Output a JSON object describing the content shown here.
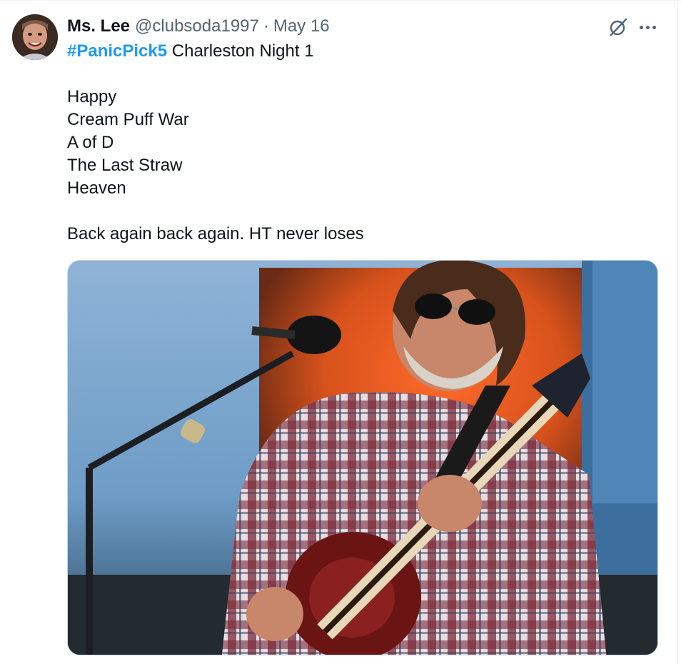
{
  "tweet": {
    "author": {
      "display_name": "Ms. Lee",
      "handle": "@clubsoda1997",
      "avatar_icon": "profile-photo"
    },
    "separator": "·",
    "date": "May 16",
    "hashtag": "#PanicPick5",
    "title_text": " Charleston Night 1",
    "setlist": [
      "Happy",
      "Cream Puff War",
      "A of D",
      "The Last Straw",
      "Heaven"
    ],
    "closing_line": "Back again back again. HT never loses",
    "media": {
      "kind": "photo",
      "subject": "guitarist-on-stage"
    }
  },
  "actions": {
    "grok_icon": "grok-icon",
    "more_icon": "more-horizontal-icon"
  },
  "colors": {
    "text": "#0f1419",
    "secondary": "#536471",
    "link": "#1d9bf0",
    "border": "#cfd9de"
  }
}
